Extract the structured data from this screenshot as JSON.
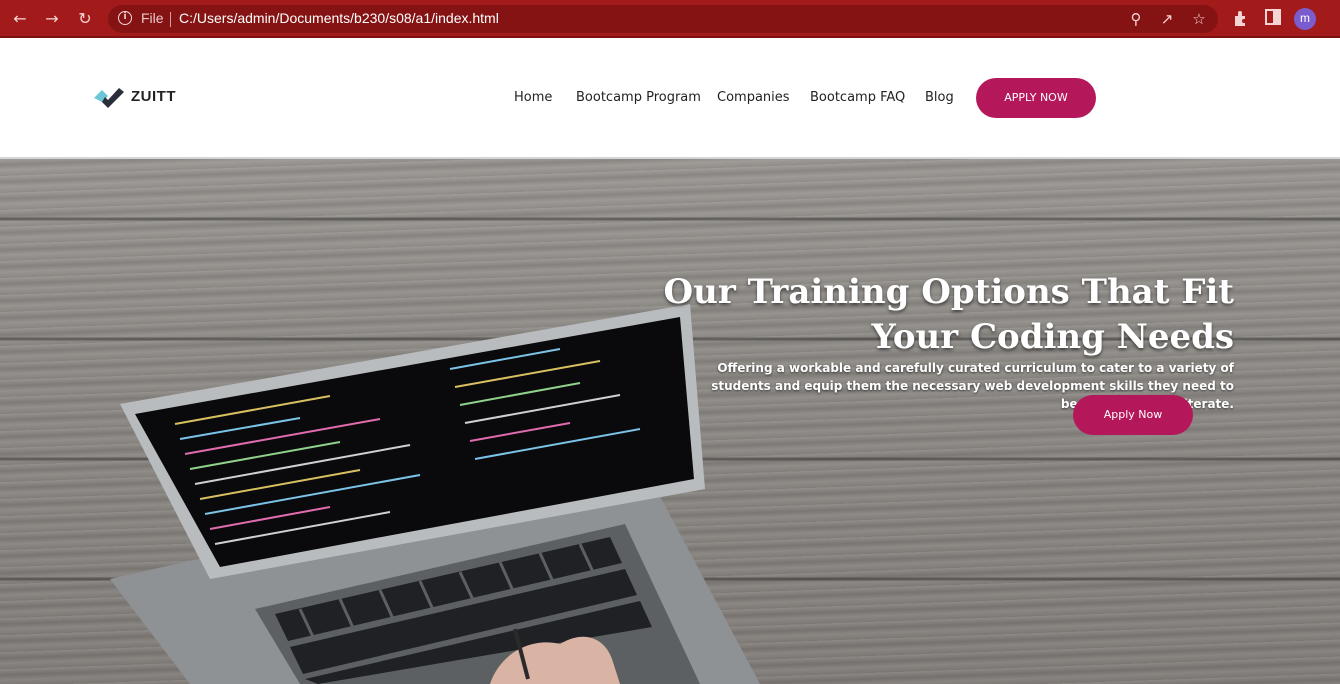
{
  "browser": {
    "file_label": "File",
    "url": "C:/Users/admin/Documents/b230/s08/a1/index.html",
    "profile_initial": "m",
    "icons": [
      "back-arrow-icon",
      "forward-arrow-icon",
      "reload-icon",
      "info-icon",
      "zoom-icon",
      "share-icon",
      "star-icon",
      "extensions-icon",
      "side-panel-icon"
    ]
  },
  "navbar": {
    "logo_text": "ZUITT",
    "links": [
      "Home",
      "Bootcamp Program",
      "Companies",
      "Bootcamp FAQ",
      "Blog"
    ],
    "cta": "APPLY NOW"
  },
  "hero": {
    "title": "Our Training Options That Fit Your Coding Needs",
    "subtitle": "Offering a workable and carefully curated curriculum to cater to a variety of students and equip them the necessary web development skills they need to become a coding literate.",
    "cta": "Apply Now"
  },
  "colors": {
    "chrome": "#a31a1a",
    "accent": "#b5185a"
  }
}
